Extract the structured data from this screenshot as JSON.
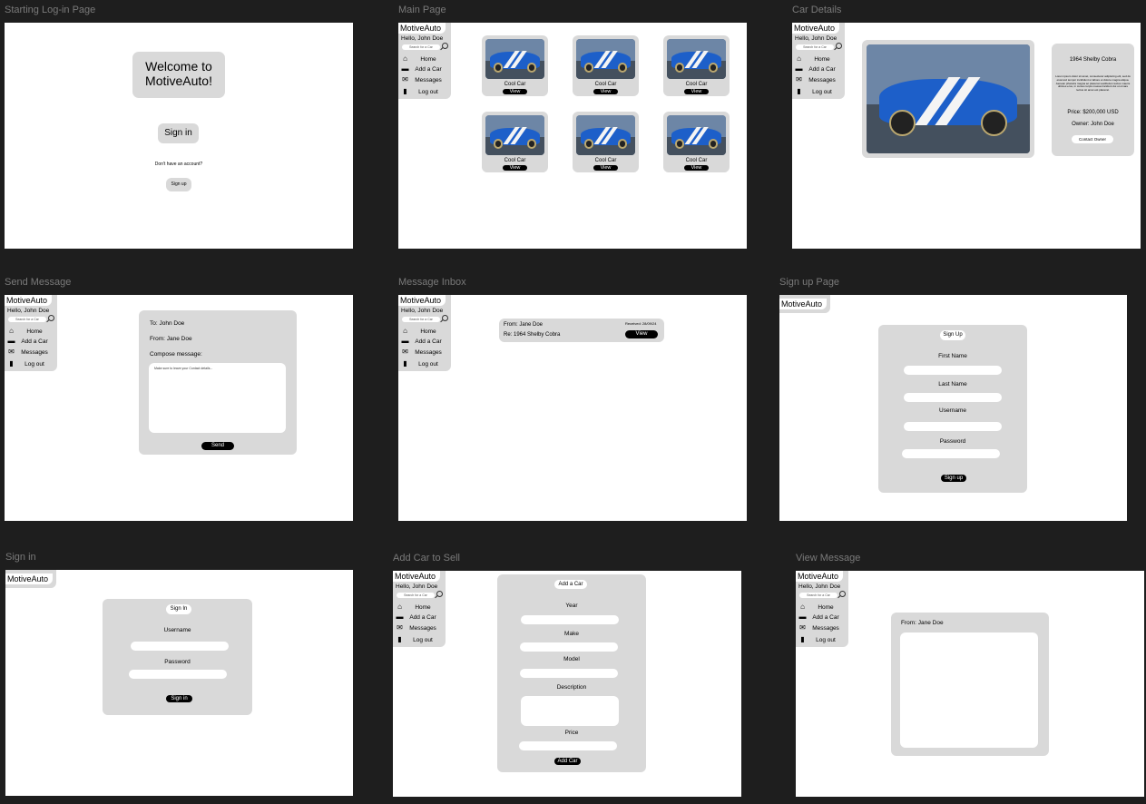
{
  "labels": {
    "start": "Starting Log-in Page",
    "main": "Main Page",
    "details": "Car Details",
    "send": "Send Message",
    "inbox": "Message Inbox",
    "signup": "Sign up Page",
    "signin": "Sign in",
    "addcar": "Add Car to Sell",
    "view": "View Message"
  },
  "sidebar": {
    "brand": "MotiveAuto",
    "hello": "Hello, John Doe",
    "search_placeholder": "Search for a Car",
    "items": [
      {
        "icon": "home-icon",
        "label": "Home"
      },
      {
        "icon": "car-icon",
        "label": "Add a Car"
      },
      {
        "icon": "envelope-icon",
        "label": "Messages"
      },
      {
        "icon": "door-icon",
        "label": "Log out"
      }
    ]
  },
  "start": {
    "welcome": "Welcome to MotiveAuto!",
    "sign_in": "Sign in",
    "no_account": "Don't have an account?",
    "sign_up": "Sign up"
  },
  "main": {
    "cards": [
      {
        "title": "Cool Car",
        "button": "View"
      },
      {
        "title": "Cool Car",
        "button": "View"
      },
      {
        "title": "Cool Car",
        "button": "View"
      },
      {
        "title": "Cool Car",
        "button": "View"
      },
      {
        "title": "Cool Car",
        "button": "View"
      },
      {
        "title": "Cool Car",
        "button": "View"
      }
    ]
  },
  "details": {
    "title": "1964 Shelby Cobra",
    "description": "Lorem ipsum dolor sit amet, consectetur adipiscing elit, sed do eiusmod tempor incididunt ut labore et dolore magna aliqua. Aenean pharetra magna ac placerat vestibulum lectus mauris ultrices eros, in cursus turpis massa tincidunt dui ut ornare lectus sit amet est placerat.",
    "price": "Price: $200,000 USD",
    "owner": "Owner: John Doe",
    "contact": "Contact Owner"
  },
  "send": {
    "to": "To: John Doe",
    "from": "From: Jane Doe",
    "compose": "Compose message:",
    "placeholder": "Make sure to leave your Contact details...",
    "send": "Send"
  },
  "inbox": {
    "from": "From: Jane Doe",
    "received": "Received: 28/09/24",
    "re": "Re: 1964 Shelby Cobra",
    "view": "View"
  },
  "signup": {
    "brand": "MotiveAuto",
    "header": "Sign Up",
    "first": "First Name",
    "last": "Last Name",
    "username": "Username",
    "password": "Password",
    "button": "Sign up"
  },
  "signin": {
    "brand": "MotiveAuto",
    "header": "Sign In",
    "username": "Username",
    "password": "Password",
    "button": "Sign in"
  },
  "addcar": {
    "header": "Add a Car",
    "year": "Year",
    "make": "Make",
    "model": "Model",
    "description": "Description",
    "price": "Price",
    "button": "Add Car"
  },
  "view": {
    "from": "From: Jane Doe"
  },
  "colors": {
    "canvas": "#1e1e1e",
    "panel": "#d9d9d9",
    "accent": "#000000",
    "car_blue": "#1d5fc9"
  }
}
